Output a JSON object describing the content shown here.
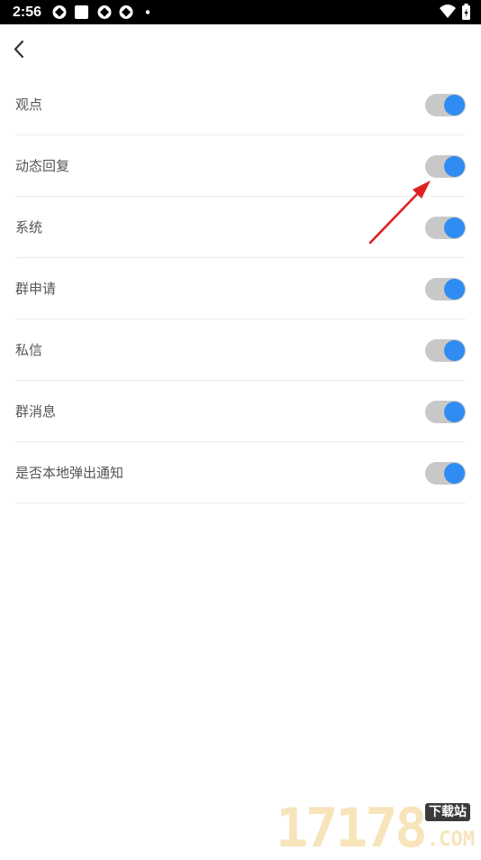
{
  "status_bar": {
    "time": "2:56",
    "left_icons": [
      "app-notification-icon",
      "stop-square-icon",
      "app-notification-icon",
      "app-notification-icon",
      "dot-icon"
    ],
    "right_icons": [
      "wifi-icon",
      "battery-charging-icon"
    ]
  },
  "header": {
    "back_icon": "chevron-left-icon"
  },
  "settings": {
    "items": [
      {
        "label": "观点",
        "enabled": true
      },
      {
        "label": "动态回复",
        "enabled": true
      },
      {
        "label": "系统",
        "enabled": true
      },
      {
        "label": "群申请",
        "enabled": true
      },
      {
        "label": "私信",
        "enabled": true
      },
      {
        "label": "群消息",
        "enabled": true
      },
      {
        "label": "是否本地弹出通知",
        "enabled": true
      }
    ]
  },
  "colors": {
    "toggle_on_knob": "#2f8cf2",
    "toggle_track": "#c8c8c8",
    "annotation_arrow": "#e02020",
    "status_bar_bg": "#000000"
  },
  "watermark": {
    "digits": "17178",
    "badge": "下载站",
    "domain": ".COM"
  }
}
